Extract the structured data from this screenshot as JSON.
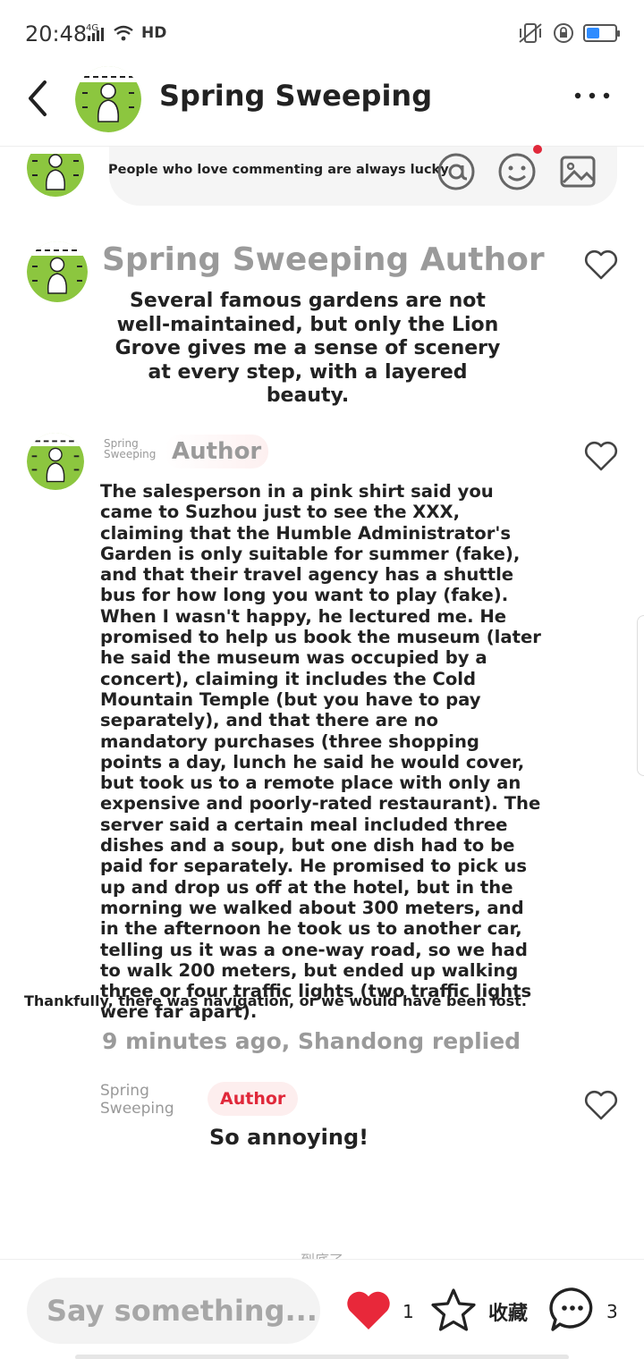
{
  "status_bar": {
    "time": "20:48",
    "network": "4G",
    "wifi_label": "HD",
    "battery_level": 0.45
  },
  "header": {
    "title": "Spring Sweeping"
  },
  "composer": {
    "hint": "People who love commenting are always lucky."
  },
  "comments": [
    {
      "name": "Spring Sweeping Author",
      "body": "Several famous gardens are not well-maintained, but only the Lion Grove gives me a sense of scenery at every step, with a layered beauty.",
      "liked": false
    },
    {
      "name": "Spring Sweeping",
      "tag": "Author",
      "body": "The salesperson in a pink shirt said you came to Suzhou just to see the XXX, claiming that the Humble Administrator's Garden is only suitable for summer (fake), and that their travel agency has a shuttle bus for how long you want to play (fake). When I wasn't happy, he lectured me. He promised to help us book the museum (later he said the museum was occupied by a concert), claiming it includes the Cold Mountain Temple (but you have to pay separately), and that there are no mandatory purchases (three shopping points a day, lunch he said he would cover, but took us to a remote place with only an expensive and poorly-rated restaurant). The server said a certain meal included three dishes and a soup, but one dish had to be paid for separately. He promised to pick us up and drop us off at the hotel, but in the morning we walked about 300 meters, and in the afternoon he took us to another car, telling us it was a one-way road, so we had to walk 200 meters, but ended up walking three or four traffic lights (two traffic lights were far apart).",
      "tail": "Thankfully, there was navigation, or we would have been lost.",
      "meta": "9 minutes ago, Shandong replied",
      "liked": false
    },
    {
      "name": "Spring Sweeping",
      "tag": "Author",
      "body": "So annoying!",
      "liked": false
    }
  ],
  "end_text": "到底了",
  "bottom_bar": {
    "placeholder": "Say something...",
    "like_count": "1",
    "favorite_label": "收藏",
    "comment_count": "3"
  },
  "colors": {
    "accent_red": "#e8283a",
    "muted_text": "#9a9a9a",
    "avatar_green": "#8cc63f"
  },
  "icons": [
    "back-arrow-icon",
    "more-icon",
    "at-icon",
    "emoji-icon",
    "image-icon",
    "heart-outline-icon",
    "heart-filled-icon",
    "star-icon",
    "comment-bubble-icon"
  ]
}
